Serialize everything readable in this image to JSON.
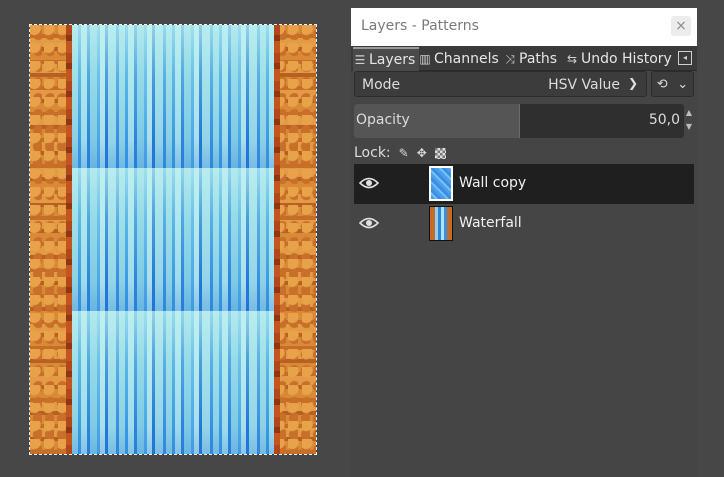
{
  "panel": {
    "title": "Layers - Patterns",
    "close_glyph": "×",
    "tabs": [
      {
        "label": "Layers",
        "icon": "layers-icon"
      },
      {
        "label": "Channels",
        "icon": "channels-icon"
      },
      {
        "label": "Paths",
        "icon": "paths-icon"
      },
      {
        "label": "Undo History",
        "icon": "undo-icon"
      }
    ],
    "tab_menu_icon": "tab-menu-icon"
  },
  "mode": {
    "label": "Mode",
    "value": "HSV Value"
  },
  "opacity": {
    "label": "Opacity",
    "value": "50,0",
    "percent": 50
  },
  "lock": {
    "label": "Lock:"
  },
  "layers": [
    {
      "name": "Wall copy",
      "visible": true,
      "selected": true
    },
    {
      "name": "Waterfall",
      "visible": true,
      "selected": false
    }
  ],
  "colors": {
    "accent_selected_row": "#1f1f1f",
    "panel_bg": "#454545"
  }
}
